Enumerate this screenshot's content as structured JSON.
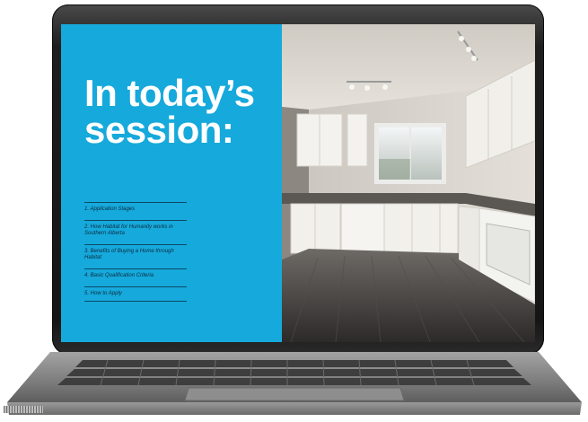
{
  "slide": {
    "title": "In today’s session:",
    "agenda": [
      "1. Application  Stages",
      "2. How Habitat for Humanity works in Southern Alberta",
      "3. Benefits of Buying a Home through Habitat",
      "4. Basic Qualification  Criteria",
      "5. How to Apply"
    ]
  },
  "colors": {
    "panel": "#16a9dc",
    "title": "#ffffff",
    "agenda_text": "#0b2c3d",
    "laptop_frame": "#1e1e1e",
    "laptop_base": "#8c8c8c"
  },
  "photo": {
    "subject": "kitchen-photo"
  }
}
